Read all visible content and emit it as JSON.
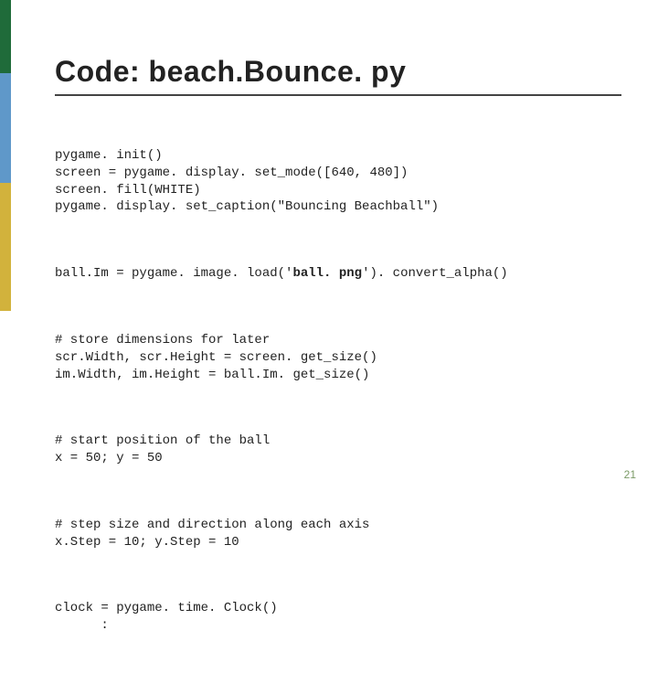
{
  "slide": {
    "title": "Code: beach.Bounce. py",
    "page_number": "21",
    "code": {
      "block1": "pygame. init()\nscreen = pygame. display. set_mode([640, 480])\nscreen. fill(WHITE)\npygame. display. set_caption(\"Bouncing Beachball\")",
      "block2_pre": "ball.Im = pygame. image. load('",
      "block2_bold": "ball. png",
      "block2_post": "'). convert_alpha()",
      "block3": "# store dimensions for later\nscr.Width, scr.Height = screen. get_size()\nim.Width, im.Height = ball.Im. get_size()",
      "block4": "# start position of the ball\nx = 50; y = 50",
      "block5": "# step size and direction along each axis\nx.Step = 10; y.Step = 10",
      "block6": "clock = pygame. time. Clock()\n      :"
    }
  }
}
